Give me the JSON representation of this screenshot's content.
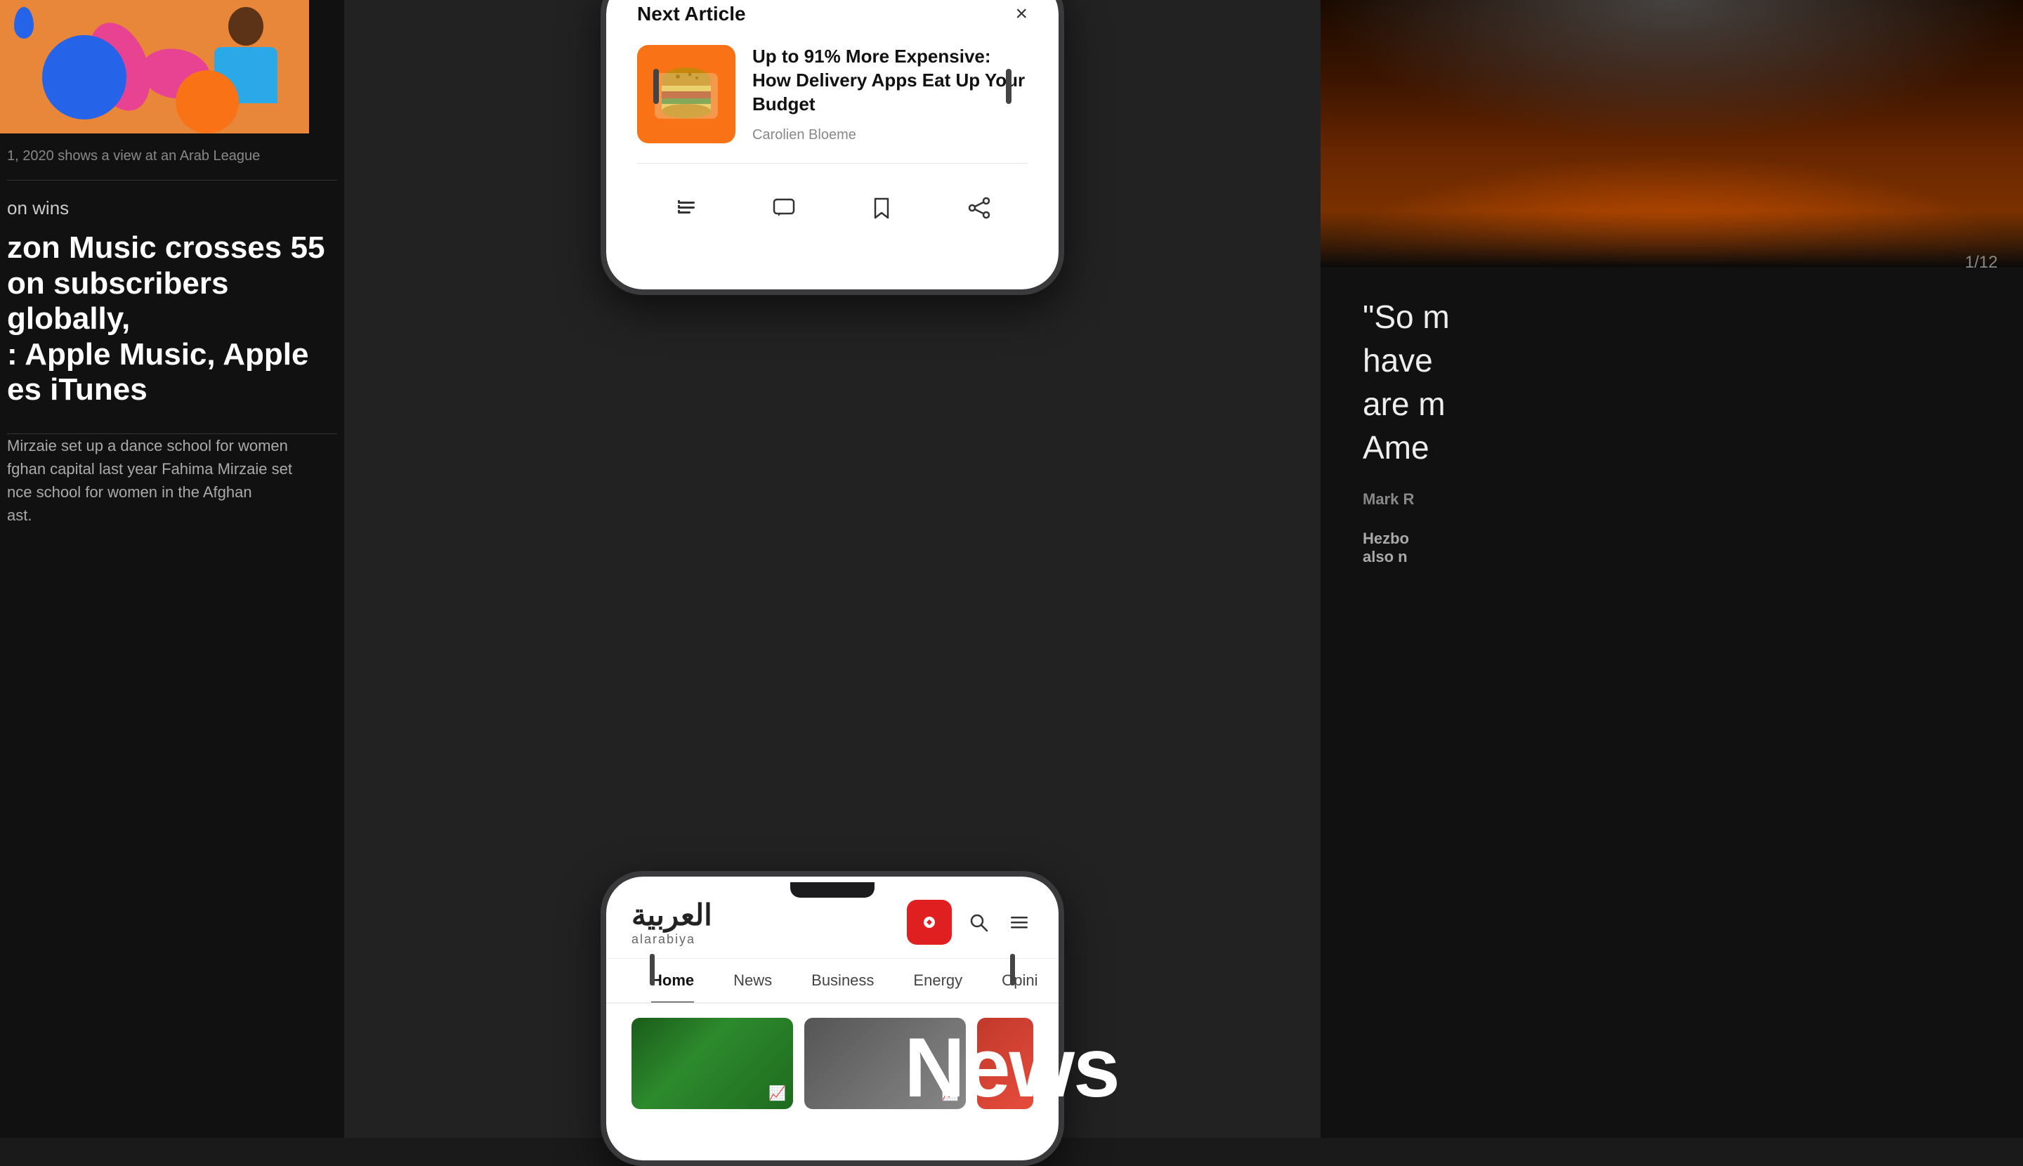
{
  "left": {
    "caption": "1, 2020 shows a view at an Arab League",
    "wins_label": "on wins",
    "headline": "zon Music crosses 55\non subscribers globally,\n: Apple Music, Apple\nes iTunes",
    "body": "Mirzaie set up a dance school for women\nfghan capital last year Fahima Mirzaie set\nnce school for women in the Afghan\nast."
  },
  "modal": {
    "title": "Next Article",
    "close_label": "×",
    "article_title": "Up to 91% More Expensive: How Delivery Apps  Eat Up Your Budget",
    "article_author": "Carolien Bloeme",
    "actions": [
      {
        "name": "text-list-icon",
        "label": "text list"
      },
      {
        "name": "comment-icon",
        "label": "comment"
      },
      {
        "name": "bookmark-icon",
        "label": "bookmark"
      },
      {
        "name": "share-icon",
        "label": "share"
      }
    ]
  },
  "alarabiya": {
    "logo_arabic": "العربية",
    "logo_sub": "alarabiya",
    "nav_items": [
      "Home",
      "News",
      "Business",
      "Energy",
      "Opini"
    ],
    "active_nav": "Home"
  },
  "right": {
    "counter": "1/12",
    "quote": "“So m\nhave\nare m\nAme",
    "byline": "Mark R",
    "subtext": "Hezbo\nalso n"
  },
  "bottom": {
    "news_label": "News"
  }
}
